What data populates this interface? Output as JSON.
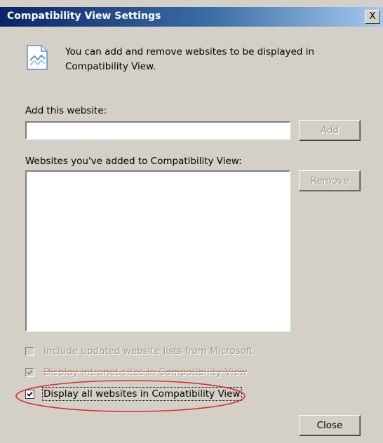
{
  "window": {
    "title": "Compatibility View Settings",
    "close_glyph": "X"
  },
  "info": {
    "icon": "webpage-icon",
    "text": "You can add and remove websites to be displayed in Compatibility View."
  },
  "add_website": {
    "label": "Add this website:",
    "value": "",
    "add_button": "Add"
  },
  "websites_list": {
    "label": "Websites you've added to Compatibility View:",
    "items": [],
    "remove_button": "Remove"
  },
  "options": [
    {
      "label": "Include updated website lists from Microsoft",
      "checked": false,
      "enabled": false
    },
    {
      "label": "Display intranet sites in Compatibility View",
      "checked": true,
      "enabled": false
    },
    {
      "label": "Display all websites in Compatibility View",
      "checked": true,
      "enabled": true
    }
  ],
  "footer": {
    "close_button": "Close"
  },
  "colors": {
    "dialog_bg": "#d4d0c8",
    "title_start": "#0a246a",
    "annotation_ellipse": "#d93030"
  }
}
